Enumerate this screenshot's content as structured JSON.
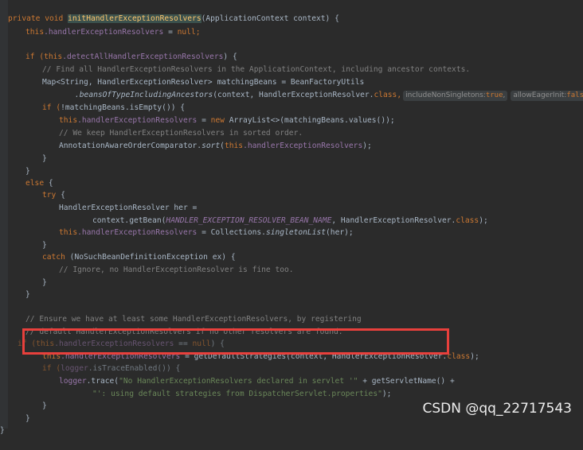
{
  "code": {
    "l1_kw": "private void ",
    "l1_method": "initHandlerExceptionResolvers",
    "l1_rest": "(ApplicationContext context) {",
    "l2_this": "this",
    "l2_field": ".handlerExceptionResolvers",
    "l2_eq": " = ",
    "l2_null": "null",
    "l2_semi": ";",
    "l4_if": "if (",
    "l4_this": "this",
    "l4_field": ".detectAllHandlerExceptionResolvers",
    "l4_rest": ") {",
    "l5_comment": "// Find all HandlerExceptionResolvers in the ApplicationContext, including ancestor contexts.",
    "l6_text": "Map<String, HandlerExceptionResolver> matchingBeans = BeanFactoryUtils",
    "l7_method": ".beansOfTypeIncludingAncestors",
    "l7_args": "(context, HandlerExceptionResolver.",
    "l7_class": "class",
    "l7_comma": ",",
    "hint1_label": "includeNonSingletons:",
    "hint1_value": "true",
    "hint1_comma": ",",
    "hint2_label": "allowEagerInit:",
    "hint2_value": "false",
    "l7_end": ");",
    "l8_if": "if (",
    "l8_rest": "!matchingBeans.isEmpty()) {",
    "l9_this": "this",
    "l9_field": ".handlerExceptionResolvers",
    "l9_eq": " = ",
    "l9_new": "new",
    "l9_rest": " ArrayList<>(matchingBeans.values());",
    "l10_comment": "// We keep HandlerExceptionResolvers in sorted order.",
    "l11_a": "AnnotationAwareOrderComparator.",
    "l11_sort": "sort",
    "l11_b": "(",
    "l11_this": "this",
    "l11_field": ".handlerExceptionResolvers",
    "l11_c": ");",
    "l12": "}",
    "l13": "}",
    "l14_else": "else",
    "l14_rest": " {",
    "l15_try": "try",
    "l15_rest": " {",
    "l16": "HandlerExceptionResolver her =",
    "l17_a": "context.getBean(",
    "l17_const": "HANDLER_EXCEPTION_RESOLVER_BEAN_NAME",
    "l17_b": ", HandlerExceptionResolver.",
    "l17_class": "class",
    "l17_c": ");",
    "l18_this": "this",
    "l18_field": ".handlerExceptionResolvers",
    "l18_a": " = Collections.",
    "l18_method": "singletonList",
    "l18_b": "(her);",
    "l19": "}",
    "l20_catch": "catch",
    "l20_rest": " (NoSuchBeanDefinitionException ex) {",
    "l21_comment": "// Ignore, no HandlerExceptionResolver is fine too.",
    "l22": "}",
    "l23": "}",
    "l25_comment": "// Ensure we have at least some HandlerExceptionResolvers, by registering",
    "l26_comment": "// default HandlerExceptionResolvers if no other resolvers are found.",
    "l27_if": "if (",
    "l27_this": "this",
    "l27_field": ".handlerExceptionResolvers",
    "l27_eq": " == ",
    "l27_null": "null",
    "l27_rest": ") {",
    "l28_this": "this",
    "l28_field": ".handlerExceptionResolvers",
    "l28_a": " = getDefaultStrategies(context, HandlerExceptionResolver.",
    "l28_class": "class",
    "l28_b": ");",
    "l29_if": "if (",
    "l29_fld": "logger",
    "l29_rest": ".isTraceEnabled()) {",
    "l30_fld": "logger",
    "l30_a": ".trace(",
    "l30_str": "\"No HandlerExceptionResolvers declared in servlet '\"",
    "l30_b": " + getServletName() +",
    "l31_str": "\"': using default strategies from DispatcherServlet.properties\"",
    "l31_b": ");",
    "l32": "}",
    "l33": "}",
    "l34": "}"
  },
  "watermark": "CSDN @qq_22717543"
}
